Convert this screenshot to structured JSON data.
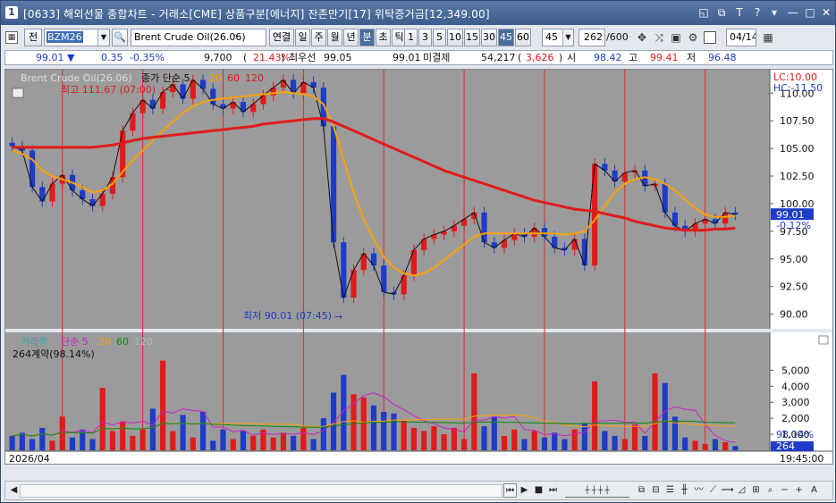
{
  "window": {
    "app_number": "1",
    "title": "[0633] 해외선물 종합차트 - 거래소[CME] 상품구분[에너지] 잔존만기[17] 위탁증거금[12,349.00]"
  },
  "toolbar": {
    "code_prefix": "전",
    "code": "BZM26",
    "product_name": "Brent Crude Oil(26.06)",
    "period_buttons": [
      "연결",
      "일",
      "주",
      "월",
      "년",
      "분",
      "초",
      "틱"
    ],
    "active_period": "분",
    "interval_buttons": [
      "1",
      "3",
      "5",
      "10",
      "15",
      "30",
      "45",
      "60"
    ],
    "active_interval": "45",
    "interval_value": "45",
    "count_value": "262",
    "count_total": "/600",
    "date_value": "04/14"
  },
  "quote": {
    "price": "99.01",
    "direction": "▼",
    "change": "0.35",
    "change_pct": "-0.35%",
    "volume": "9,700",
    "volume_ratio": "21.43%",
    "best_bid_label": "최우선",
    "best_bid": "99.05",
    "best_ask": "99.01",
    "open_interest_label": "미결제",
    "open_interest": "54,217",
    "open_interest_change": "3,626",
    "open_label": "시",
    "open": "98.42",
    "high_label": "고",
    "high": "99.41",
    "low_label": "저",
    "low": "96.48"
  },
  "price_panel": {
    "legend_name": "Brent Crude Oil(26.06)",
    "legend_ma_label": "종가 단순 5",
    "legend_ma_periods": [
      "20",
      "60",
      "120"
    ],
    "high_annotation": "최고 111.67 (07:00)",
    "low_annotation": "최저 90.01 (07:45)",
    "lc_label": "LC:10.00",
    "hc_label": "HC:-11.50",
    "y_ticks": [
      "110.00",
      "107.50",
      "105.00",
      "102.50",
      "100.00",
      "97.50",
      "95.00",
      "92.50",
      "90.00"
    ],
    "current_price_tag": "99.01",
    "current_pct_tag": "-0.12%"
  },
  "volume_panel": {
    "legend_name": "거래량",
    "legend_ma_label": "단순 5",
    "legend_ma_periods": [
      "20",
      "60",
      "120"
    ],
    "contract_label": "264계약(98.14%)",
    "y_ticks": [
      "5,000",
      "4,000",
      "3,000",
      "2,000",
      "1,000"
    ],
    "current_volume_tag": "264",
    "current_pct_tag": "98.14%"
  },
  "time_axis": {
    "start_label": "2026/04",
    "end_label": "19:45:00"
  },
  "colors": {
    "chart_bg": "#9b9b9b",
    "up_candle": "#e01b1b",
    "down_candle": "#1e3cc8",
    "ma5": "#111111",
    "ma20": "#ffa000",
    "ma60": "#e01b1b",
    "session_line": "#e02828"
  },
  "chart_data": [
    {
      "type": "candlestick",
      "title": "Brent Crude Oil(26.06)",
      "y_axis_ticks": [
        110.0,
        107.5,
        105.0,
        102.5,
        100.0,
        97.5,
        95.0,
        92.5,
        90.0
      ],
      "ylim": [
        89.0,
        111.8
      ],
      "series": [
        {
          "name": "close",
          "values": [
            105.2,
            104.8,
            101.5,
            100.2,
            101.8,
            102.6,
            101.2,
            100.4,
            99.8,
            100.9,
            102.4,
            106.6,
            108.2,
            109.4,
            108.6,
            110.1,
            110.8,
            109.5,
            111.2,
            110.4,
            109.0,
            108.6,
            109.2,
            108.3,
            109.0,
            109.8,
            110.5,
            111.2,
            110.0,
            111.0,
            110.5,
            107.0,
            96.5,
            91.5,
            94.0,
            95.5,
            94.4,
            92.0,
            91.8,
            93.5,
            95.8,
            96.8,
            97.2,
            97.5,
            98.0,
            98.6,
            99.2,
            96.5,
            96.0,
            96.7,
            97.3,
            97.0,
            97.8,
            97.0,
            96.0,
            95.8,
            96.8,
            94.4,
            103.6,
            103.0,
            102.0,
            102.8,
            103.0,
            101.6,
            101.8,
            99.2,
            98.0,
            97.5,
            98.2,
            98.6,
            98.2,
            99.2,
            99.01
          ]
        },
        {
          "name": "단순 20",
          "values": [
            104.8,
            104.5,
            104.0,
            103.0,
            102.5,
            102.2,
            101.9,
            101.5,
            101.0,
            101.2,
            101.8,
            102.9,
            103.9,
            104.8,
            105.7,
            106.6,
            107.4,
            108.2,
            108.8,
            109.2,
            109.4,
            109.5,
            109.6,
            109.7,
            109.8,
            109.9,
            110.0,
            110.1,
            110.0,
            109.9,
            109.7,
            109.0,
            107.0,
            104.0,
            101.0,
            98.6,
            96.8,
            95.2,
            94.2,
            93.7,
            93.5,
            93.7,
            94.2,
            94.9,
            95.6,
            96.3,
            97.0,
            97.3,
            97.3,
            97.3,
            97.3,
            97.3,
            97.3,
            97.3,
            97.3,
            97.2,
            97.3,
            97.5,
            98.5,
            99.8,
            101.0,
            101.8,
            102.2,
            102.4,
            102.2,
            101.8,
            101.2,
            100.4,
            99.6,
            99.0,
            98.8,
            98.8,
            98.9
          ]
        },
        {
          "name": "단순 60",
          "values": [
            105.1,
            105.1,
            105.1,
            105.1,
            105.1,
            105.1,
            105.1,
            105.1,
            105.1,
            105.2,
            105.3,
            105.5,
            105.7,
            105.9,
            106.0,
            106.1,
            106.2,
            106.3,
            106.4,
            106.5,
            106.6,
            106.7,
            106.8,
            106.9,
            107.0,
            107.2,
            107.3,
            107.4,
            107.5,
            107.6,
            107.7,
            107.7,
            107.4,
            107.0,
            106.6,
            106.2,
            105.8,
            105.4,
            105.0,
            104.6,
            104.2,
            103.8,
            103.4,
            103.0,
            102.7,
            102.4,
            102.1,
            101.8,
            101.5,
            101.2,
            100.9,
            100.6,
            100.3,
            100.1,
            99.9,
            99.7,
            99.5,
            99.4,
            99.3,
            99.1,
            98.9,
            98.7,
            98.4,
            98.2,
            98.0,
            97.8,
            97.7,
            97.6,
            97.6,
            97.6,
            97.7,
            97.7,
            97.8
          ]
        }
      ]
    },
    {
      "type": "bar",
      "title": "거래량",
      "y_axis_ticks": [
        5000,
        4000,
        3000,
        2000,
        1000
      ],
      "ylim": [
        0,
        5800
      ],
      "series": [
        {
          "name": "volume",
          "values": [
            900,
            1100,
            700,
            1400,
            600,
            2100,
            800,
            1300,
            700,
            3900,
            1200,
            1800,
            900,
            1300,
            2600,
            5600,
            1200,
            2200,
            800,
            2400,
            600,
            1300,
            700,
            1200,
            900,
            1300,
            800,
            1100,
            900,
            1400,
            700,
            2000,
            3600,
            4700,
            3500,
            3300,
            2800,
            2400,
            2300,
            1900,
            1400,
            1200,
            1500,
            1000,
            1400,
            700,
            4800,
            1500,
            2100,
            900,
            1300,
            700,
            1200,
            800,
            1100,
            700,
            1300,
            1700,
            4300,
            1200,
            900,
            700,
            1600,
            900,
            4800,
            4200,
            2100,
            800,
            600,
            400,
            700,
            500,
            264
          ]
        }
      ]
    }
  ]
}
